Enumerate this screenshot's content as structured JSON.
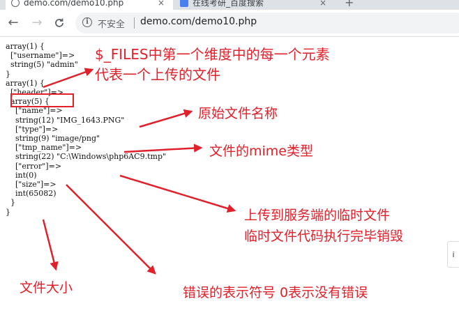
{
  "browser": {
    "tabs": [
      {
        "title": "demo.com/demo10.php",
        "active": true
      },
      {
        "title": "在线考研_百度搜索",
        "active": false
      }
    ],
    "close_glyph": "×",
    "new_tab_glyph": "+",
    "back_glyph": "←",
    "forward_glyph": "→",
    "reload_glyph": "C",
    "info_glyph": "i",
    "security_label": "不安全",
    "url": "demo.com/demo10.php"
  },
  "dump": {
    "lines": [
      "array(1) {",
      "  [\"username\"]=>",
      "  string(5) \"admin\"",
      "}",
      "array(1) {",
      "  [\"header\"]=>",
      "  array(5) {",
      "    [\"name\"]=>",
      "    string(12) \"IMG_1643.PNG\"",
      "    [\"type\"]=>",
      "    string(9) \"image/png\"",
      "    [\"tmp_name\"]=>",
      "    string(22) \"C:\\Windows\\php6AC9.tmp\"",
      "    [\"error\"]=>",
      "    int(0)",
      "    [\"size\"]=>",
      "    int(65082)",
      "  }",
      "}"
    ]
  },
  "annotations": {
    "files_dim_line1": "$_FILES中第一个维度中的每一个元素",
    "files_dim_line2": "代表一个上传的文件",
    "name_note": "原始文件名称",
    "type_note": "文件的mime类型",
    "tmp_line1": "上传到服务端的临时文件",
    "tmp_line2": "临时文件代码执行完毕销毁",
    "size_note": "文件大小",
    "error_note": "错误的表示符号 0表示没有错误"
  },
  "side_tab": {
    "label": "i"
  },
  "colors": {
    "annotation": "#e0202a",
    "code_text": "#111111",
    "toolbar_bg": "#ffffff",
    "omnibox_bg": "#f1f3f4"
  }
}
